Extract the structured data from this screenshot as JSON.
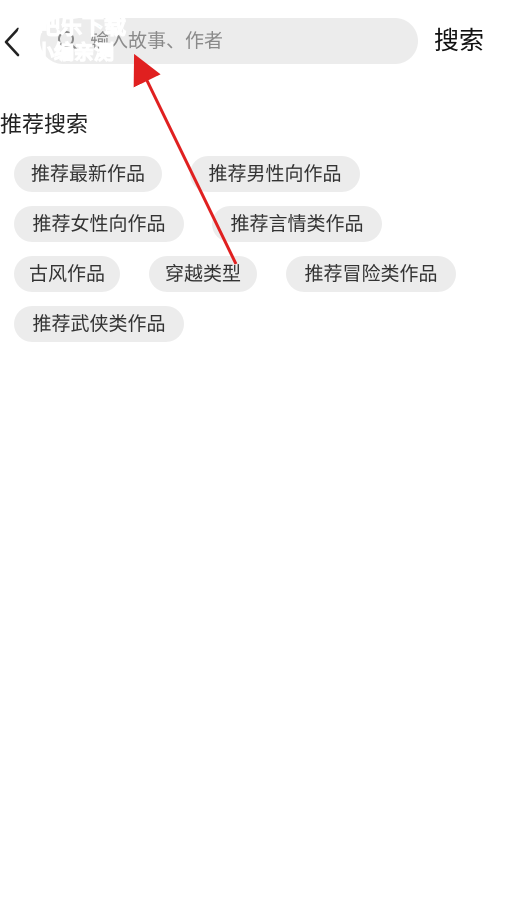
{
  "header": {
    "search_placeholder": "输入故事、作者",
    "search_button_label": "搜索",
    "icons": {
      "back": "back-arrow-icon",
      "search": "search-icon"
    }
  },
  "recommended": {
    "title": "推荐搜索",
    "tags": [
      "推荐最新作品",
      "推荐男性向作品",
      "推荐女性向作品",
      "推荐言情类作品",
      "古风作品",
      "穿越类型",
      "推荐冒险类作品",
      "推荐武侠类作品"
    ]
  },
  "watermark": {
    "line1": "游吧乐下载",
    "line2": "小编亲测"
  },
  "colors": {
    "tag_background": "#ececec",
    "search_background": "#ececec",
    "annotation_arrow": "#e02020",
    "watermark": "#19c8e6"
  }
}
